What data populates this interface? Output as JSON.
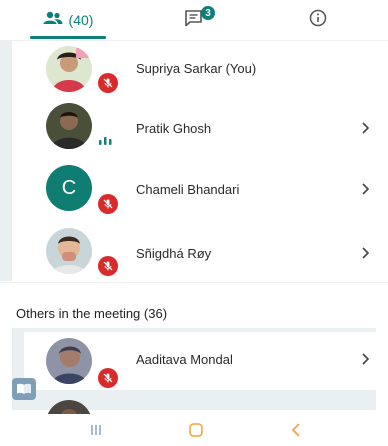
{
  "tabs": {
    "people": {
      "label": "(40)",
      "icon": "people-icon",
      "active": true
    },
    "chat": {
      "icon": "chat-icon",
      "badge": "3"
    },
    "info": {
      "icon": "info-icon"
    }
  },
  "participants": [
    {
      "name": "Supriya Sarkar (You)",
      "status": "muted",
      "avatar": "photo",
      "has_chevron": false
    },
    {
      "name": "Pratik Ghosh",
      "status": "speaking",
      "avatar": "photo",
      "has_chevron": true
    },
    {
      "name": "Chameli Bhandari",
      "status": "muted",
      "avatar": "letter",
      "avatar_letter": "C",
      "has_chevron": true
    },
    {
      "name": "Sñigdhá Røy",
      "status": "muted",
      "avatar": "photo",
      "has_chevron": true
    }
  ],
  "others": {
    "title": "Others in the meeting (36)",
    "participants": [
      {
        "name": "Aaditava Mondal",
        "status": "muted",
        "avatar": "photo",
        "has_chevron": true
      }
    ]
  },
  "colors": {
    "accent": "#0b7f7a",
    "mute_red": "#d92b2b",
    "nav_recents": "#8fa9c9",
    "nav_home": "#f2a640",
    "nav_back": "#f2a640"
  },
  "navbar": {
    "recents_icon": "recents-icon",
    "home_icon": "home-icon",
    "back_icon": "back-icon"
  }
}
